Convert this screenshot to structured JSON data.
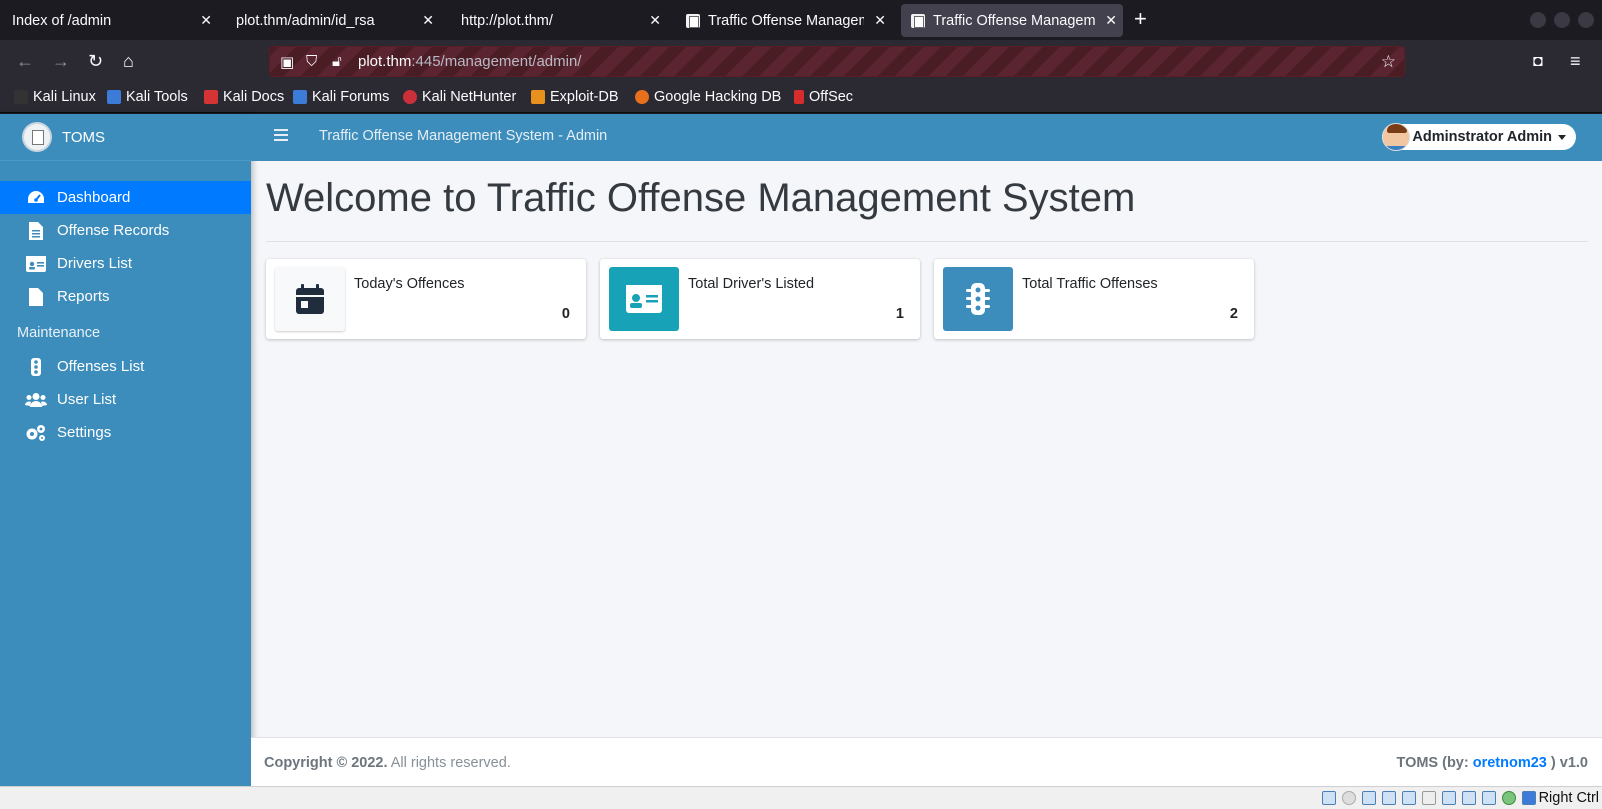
{
  "browser": {
    "tabs": [
      {
        "title": "Index of /admin",
        "active": false
      },
      {
        "title": "plot.thm/admin/id_rsa",
        "active": false
      },
      {
        "title": "http://plot.thm/",
        "active": false
      },
      {
        "title": "Traffic Offense Management",
        "active": false
      },
      {
        "title": "Traffic Offense Management",
        "active": true
      }
    ],
    "url_host": "plot.thm",
    "url_rest": ":445/management/admin/",
    "bookmarks": [
      "Kali Linux",
      "Kali Tools",
      "Kali Docs",
      "Kali Forums",
      "Kali NetHunter",
      "Exploit-DB",
      "Google Hacking DB",
      "OffSec"
    ]
  },
  "sidebar": {
    "brand": "TOMS",
    "items": [
      {
        "label": "Dashboard",
        "icon": "tachometer-icon",
        "active": true
      },
      {
        "label": "Offense Records",
        "icon": "file-alt-icon"
      },
      {
        "label": "Drivers List",
        "icon": "id-card-icon"
      },
      {
        "label": "Reports",
        "icon": "file-icon"
      }
    ],
    "maintenance_header": "Maintenance",
    "maintenance_items": [
      {
        "label": "Offenses List",
        "icon": "traffic-light-icon"
      },
      {
        "label": "User List",
        "icon": "users-icon"
      },
      {
        "label": "Settings",
        "icon": "cogs-icon"
      }
    ]
  },
  "topnav": {
    "title": "Traffic Offense Management System - Admin",
    "user": "Adminstrator Admin"
  },
  "main": {
    "heading": "Welcome to Traffic Offense Management System",
    "cards": [
      {
        "label": "Today's Offences",
        "value": "0",
        "icon": "calendar-icon",
        "color": "#f8f9fa"
      },
      {
        "label": "Total Driver's Listed",
        "value": "1",
        "icon": "id-card-icon",
        "color": "#17a2b8"
      },
      {
        "label": "Total Traffic Offenses",
        "value": "2",
        "icon": "traffic-light-icon",
        "color": "#3c8dbc"
      }
    ]
  },
  "footer": {
    "copyright": "Copyright © 2022.",
    "rights": "All rights reserved.",
    "credit_prefix": "TOMS (by:",
    "credit_author": "oretnom23",
    "credit_suffix": ") v1.0"
  },
  "statusbar": {
    "host_key": "Right Ctrl"
  },
  "colors": {
    "sidebar": "#3c8dbc",
    "active": "#007bff",
    "info": "#17a2b8"
  }
}
